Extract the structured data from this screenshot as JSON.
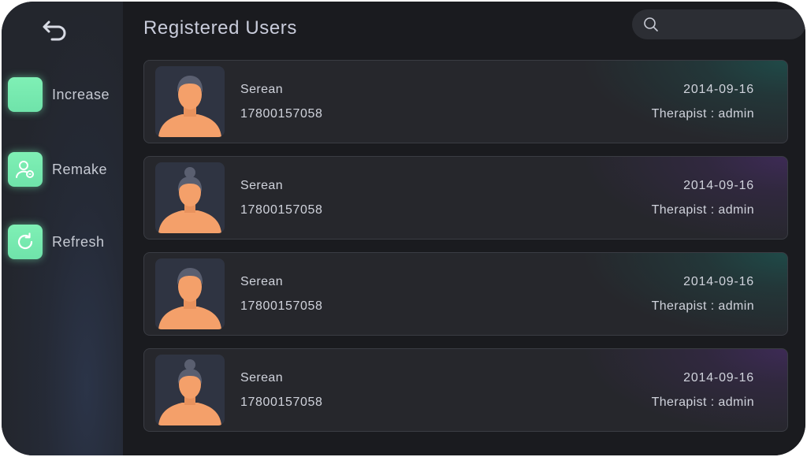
{
  "header": {
    "title": "Registered Users",
    "search_placeholder": ""
  },
  "sidebar": {
    "back_icon": "back-arrow-icon",
    "items": [
      {
        "label": "Increase",
        "icon": "add-user-icon"
      },
      {
        "label": "Remake",
        "icon": "edit-user-icon"
      },
      {
        "label": "Refresh",
        "icon": "refresh-icon"
      }
    ]
  },
  "users": [
    {
      "name": "Serean",
      "phone": "17800157058",
      "date": "2014-09-16",
      "therapist": "Therapist : admin",
      "avatar": "male-avatar",
      "accent": "teal"
    },
    {
      "name": "Serean",
      "phone": "17800157058",
      "date": "2014-09-16",
      "therapist": "Therapist : admin",
      "avatar": "female-avatar",
      "accent": "purple"
    },
    {
      "name": "Serean",
      "phone": "17800157058",
      "date": "2014-09-16",
      "therapist": "Therapist : admin",
      "avatar": "male-avatar",
      "accent": "teal"
    },
    {
      "name": "Serean",
      "phone": "17800157058",
      "date": "2014-09-16",
      "therapist": "Therapist : admin",
      "avatar": "female-avatar",
      "accent": "purple"
    }
  ],
  "colors": {
    "accent_green": "#74eab0",
    "avatar_skin": "#f4a06a",
    "avatar_hair": "#5a5f70",
    "text": "#d0d3dc"
  }
}
